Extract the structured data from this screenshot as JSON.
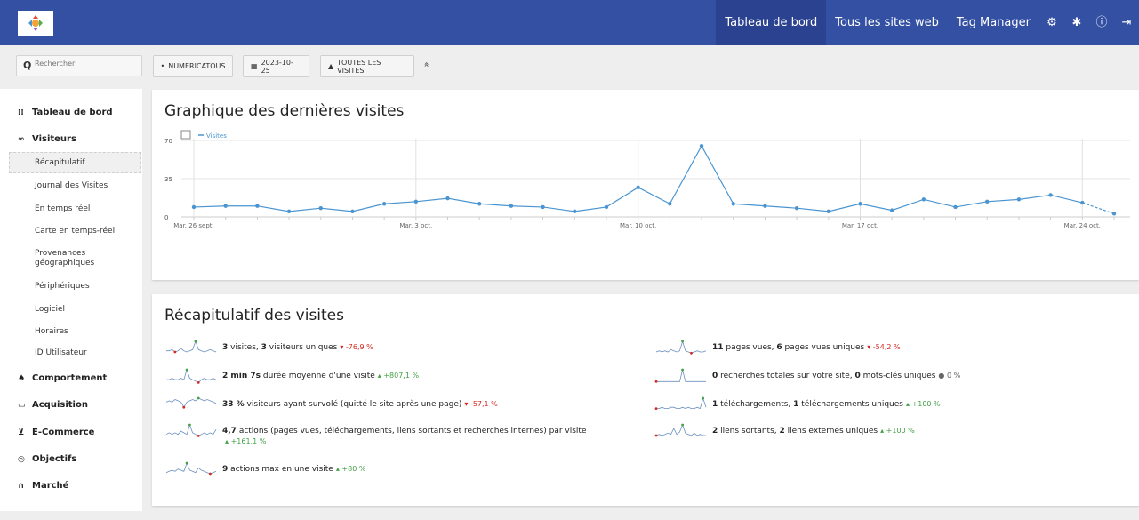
{
  "topnav": {
    "links": [
      "Tableau de bord",
      "Tous les sites web",
      "Tag Manager"
    ],
    "icons": [
      "gear-icon",
      "bell-icon",
      "info-icon",
      "logout-icon"
    ]
  },
  "controls": {
    "search_placeholder": "Rechercher",
    "site": "NUMERICATOUS",
    "date": "2023-10-25",
    "segment": "TOUTES LES VISITES",
    "collapse": "»"
  },
  "sidebar": {
    "dashboard": "Tableau de bord",
    "visitors": "Visiteurs",
    "visitor_items": [
      "Récapitulatif",
      "Journal des Visites",
      "En temps réel",
      "Carte en temps-réel",
      "Provenances géographiques",
      "Périphériques",
      "Logiciel",
      "Horaires",
      "ID Utilisateur"
    ],
    "behaviour": "Comportement",
    "acquisition": "Acquisition",
    "ecommerce": "E-Commerce",
    "goals": "Objectifs",
    "market": "Marché"
  },
  "evolution": {
    "title": "Graphique des dernières visites",
    "legend": "Visites"
  },
  "chart_data": {
    "type": "line",
    "title": "Graphique des dernières visites",
    "series": [
      {
        "name": "Visites",
        "color": "#4a95d1",
        "values": [
          9,
          10,
          10,
          5,
          8,
          5,
          12,
          14,
          17,
          12,
          10,
          9,
          5,
          9,
          27,
          12,
          65,
          12,
          10,
          8,
          5,
          12,
          6,
          16,
          9,
          14,
          16,
          20,
          13,
          3
        ]
      }
    ],
    "x_start": "2023-09-26",
    "x_tick_labels": [
      {
        "index": 0,
        "label": "Mar. 26 sept."
      },
      {
        "index": 7,
        "label": "Mar. 3 oct."
      },
      {
        "index": 14,
        "label": "Mar. 10 oct."
      },
      {
        "index": 21,
        "label": "Mar. 17 oct."
      },
      {
        "index": 28,
        "label": "Mar. 24 oct."
      }
    ],
    "yticks": [
      0,
      35,
      70
    ],
    "ylim": [
      0,
      70
    ],
    "grid": true,
    "last_segment_dashed": true
  },
  "summary": {
    "title": "Récapitulatif des visites",
    "left": [
      {
        "parts": [
          {
            "b": "3"
          },
          {
            "t": " visites, "
          },
          {
            "b": "3"
          },
          {
            "t": " visiteurs uniques"
          }
        ],
        "evo": "-76,9 %",
        "dir": "neg",
        "arrow": "▾"
      },
      {
        "parts": [
          {
            "b": "2 min 7s"
          },
          {
            "t": " durée moyenne d'une visite"
          }
        ],
        "evo": "+807,1 %",
        "dir": "pos",
        "arrow": "▴"
      },
      {
        "parts": [
          {
            "b": "33 %"
          },
          {
            "t": " visiteurs ayant survolé (quitté le site après une page)"
          }
        ],
        "evo": "-57,1 %",
        "dir": "neg",
        "arrow": "▾"
      },
      {
        "parts": [
          {
            "b": "4,7"
          },
          {
            "t": " actions (pages vues, téléchargements, liens sortants et recherches internes) par visite"
          }
        ],
        "evo": "+161,1 %",
        "dir": "pos",
        "arrow": "▴",
        "wrap": true
      },
      {
        "parts": [
          {
            "b": "9"
          },
          {
            "t": " actions max en une visite"
          }
        ],
        "evo": "+80 %",
        "dir": "pos",
        "arrow": "▴"
      }
    ],
    "right": [
      {
        "parts": [
          {
            "b": "11"
          },
          {
            "t": " pages vues, "
          },
          {
            "b": "6"
          },
          {
            "t": " pages vues uniques"
          }
        ],
        "evo": "-54,2 %",
        "dir": "neg",
        "arrow": "▾"
      },
      {
        "parts": [
          {
            "b": "0"
          },
          {
            "t": " recherches totales sur votre site, "
          },
          {
            "b": "0"
          },
          {
            "t": " mots-clés uniques"
          }
        ],
        "evo": "0 %",
        "dir": "neu",
        "arrow": "●"
      },
      {
        "parts": [
          {
            "b": "1"
          },
          {
            "t": " téléchargements, "
          },
          {
            "b": "1"
          },
          {
            "t": " téléchargements uniques"
          }
        ],
        "evo": "+100 %",
        "dir": "pos",
        "arrow": "▴"
      },
      {
        "parts": [
          {
            "b": "2"
          },
          {
            "t": " liens sortants, "
          },
          {
            "b": "2"
          },
          {
            "t": " liens externes uniques"
          }
        ],
        "evo": "+100 %",
        "dir": "pos",
        "arrow": "▴"
      }
    ]
  }
}
